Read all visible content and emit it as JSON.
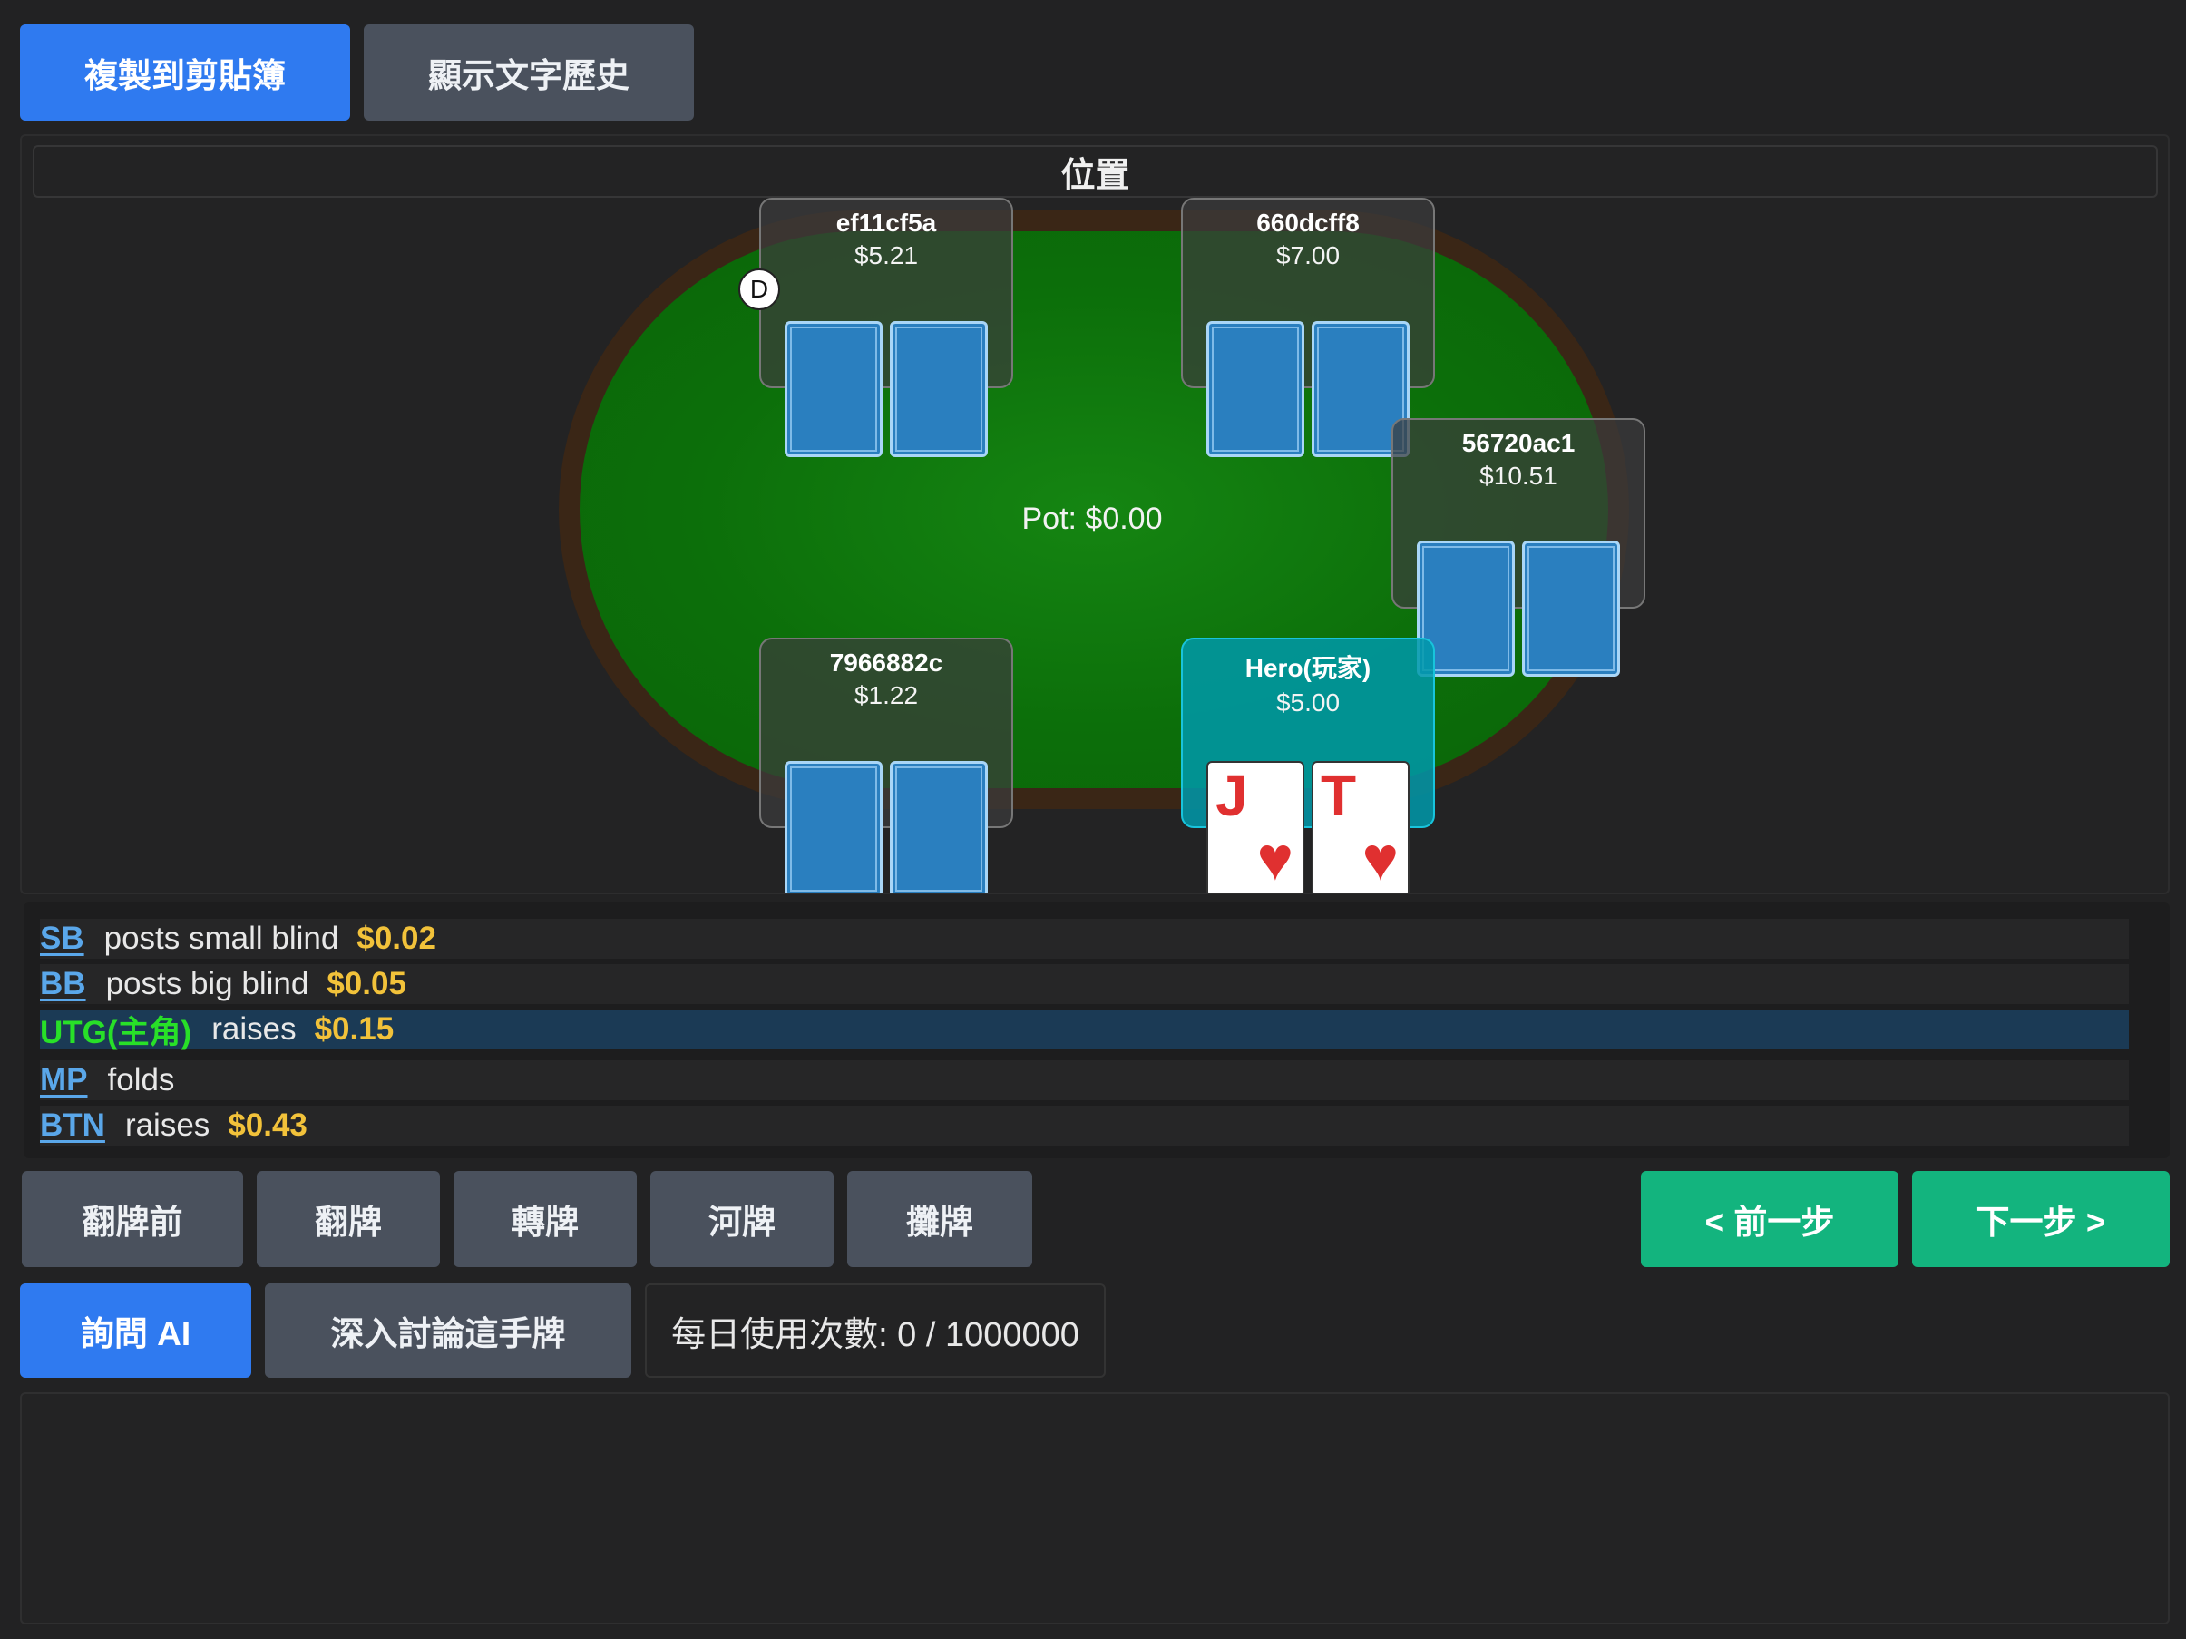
{
  "toolbar": {
    "copy_label": "複製到剪貼簿",
    "history_label": "顯示文字歷史"
  },
  "table": {
    "position_title": "位置",
    "pot": "Pot: $0.00",
    "dealer": "D",
    "seats": [
      {
        "name": "ef11cf5a",
        "stack": "$5.21"
      },
      {
        "name": "660dcff8",
        "stack": "$7.00"
      },
      {
        "name": "56720ac1",
        "stack": "$10.51"
      },
      {
        "name": "7966882c",
        "stack": "$1.22"
      },
      {
        "name": "Hero(玩家)",
        "stack": "$5.00"
      }
    ],
    "hero_cards": [
      {
        "rank": "J",
        "suit": "♥"
      },
      {
        "rank": "T",
        "suit": "♥"
      }
    ]
  },
  "log": [
    {
      "pos": "SB",
      "action": "posts small blind",
      "amount": "$0.02"
    },
    {
      "pos": "BB",
      "action": "posts big blind",
      "amount": "$0.05"
    },
    {
      "pos": "UTG(主角)",
      "action": "raises",
      "amount": "$0.15"
    },
    {
      "pos": "MP",
      "action": "folds",
      "amount": ""
    },
    {
      "pos": "BTN",
      "action": "raises",
      "amount": "$0.43"
    }
  ],
  "streets": {
    "preflop": "翻牌前",
    "flop": "翻牌",
    "turn": "轉牌",
    "river": "河牌",
    "showdown": "攤牌"
  },
  "nav": {
    "prev": "< 前一步",
    "next": "下一步 >"
  },
  "ai": {
    "ask": "詢問 AI",
    "discuss": "深入討論這手牌",
    "usage": "每日使用次數: 0 / 1000000"
  },
  "colors": {
    "accent_blue": "#2f7af0",
    "accent_green": "#13b47e",
    "amount_gold": "#f2c23a",
    "hero_highlight": "#28e028",
    "felt": "#0c6f0a"
  }
}
